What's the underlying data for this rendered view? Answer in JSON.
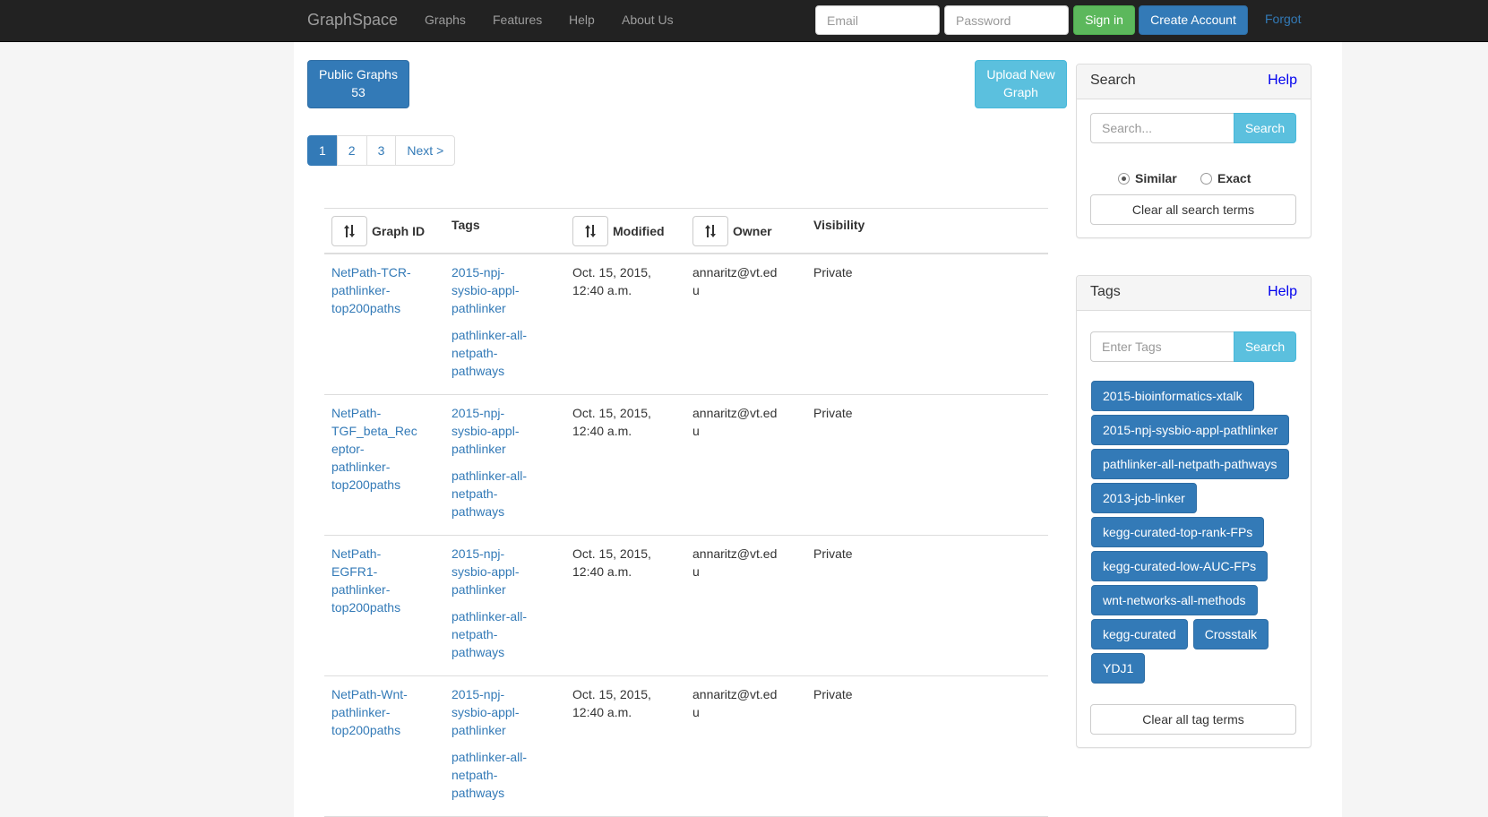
{
  "navbar": {
    "brand": "GraphSpace",
    "links": [
      "Graphs",
      "Features",
      "Help",
      "About Us"
    ],
    "email_placeholder": "Email",
    "password_placeholder": "Password",
    "signin_label": "Sign in",
    "create_account_label": "Create Account",
    "forgot_label": "Forgot"
  },
  "toolbar": {
    "public_graphs_label": "Public Graphs",
    "public_graphs_count": "53",
    "upload_label_line1": "Upload New",
    "upload_label_line2": "Graph"
  },
  "pagination": {
    "pages": [
      "1",
      "2",
      "3"
    ],
    "next_label": "Next >",
    "active_page": "1"
  },
  "table": {
    "headers": {
      "graph_id": "Graph ID",
      "tags": "Tags",
      "modified": "Modified",
      "owner": "Owner",
      "visibility": "Visibility"
    },
    "rows": [
      {
        "graph_id": "NetPath-TCR-pathlinker-top200paths",
        "tags": [
          "2015-npj-sysbio-appl-pathlinker",
          "pathlinker-all-netpath-pathways"
        ],
        "modified": "Oct. 15, 2015, 12:40 a.m.",
        "owner": "annaritz@vt.edu",
        "visibility": "Private"
      },
      {
        "graph_id": "NetPath-TGF_beta_Receptor-pathlinker-top200paths",
        "tags": [
          "2015-npj-sysbio-appl-pathlinker",
          "pathlinker-all-netpath-pathways"
        ],
        "modified": "Oct. 15, 2015, 12:40 a.m.",
        "owner": "annaritz@vt.edu",
        "visibility": "Private"
      },
      {
        "graph_id": "NetPath-EGFR1-pathlinker-top200paths",
        "tags": [
          "2015-npj-sysbio-appl-pathlinker",
          "pathlinker-all-netpath-pathways"
        ],
        "modified": "Oct. 15, 2015, 12:40 a.m.",
        "owner": "annaritz@vt.edu",
        "visibility": "Private"
      },
      {
        "graph_id": "NetPath-Wnt-pathlinker-top200paths",
        "tags": [
          "2015-npj-sysbio-appl-pathlinker",
          "pathlinker-all-netpath-pathways"
        ],
        "modified": "Oct. 15, 2015, 12:40 a.m.",
        "owner": "annaritz@vt.edu",
        "visibility": "Private"
      }
    ]
  },
  "search_panel": {
    "title": "Search",
    "help": "Help",
    "placeholder": "Search...",
    "button": "Search",
    "option_similar": "Similar",
    "option_exact": "Exact",
    "selected_option": "Similar",
    "clear_label": "Clear all search terms"
  },
  "tags_panel": {
    "title": "Tags",
    "help": "Help",
    "placeholder": "Enter Tags",
    "button": "Search",
    "tags": [
      "2015-bioinformatics-xtalk",
      "2015-npj-sysbio-appl-pathlinker",
      "pathlinker-all-netpath-pathways",
      "2013-jcb-linker",
      "kegg-curated-top-rank-FPs",
      "kegg-curated-low-AUC-FPs",
      "wnt-networks-all-methods",
      "kegg-curated",
      "Crosstalk",
      "YDJ1"
    ],
    "clear_label": "Clear all tag terms"
  },
  "colors": {
    "navbar_bg": "#222222",
    "primary": "#337ab7",
    "success": "#5cb85c",
    "info": "#5bc0de",
    "help_link": "#0000ee"
  },
  "icons": {
    "sort": "sort-arrows-icon"
  }
}
